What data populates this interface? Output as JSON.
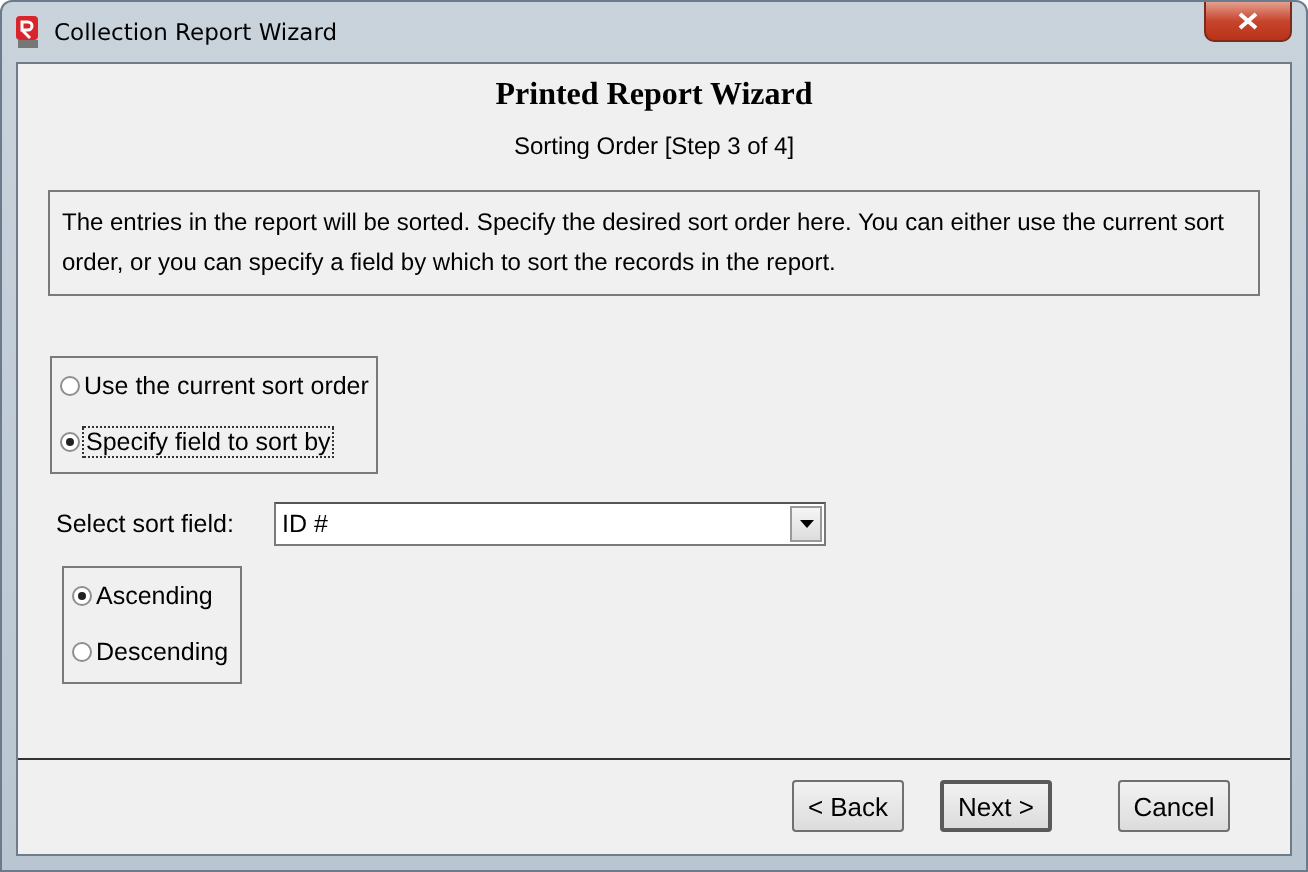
{
  "window": {
    "title": "Collection Report Wizard"
  },
  "header": {
    "title": "Printed Report Wizard",
    "subtitle": "Sorting Order [Step 3 of 4]"
  },
  "description": "The entries in the report will be sorted.  Specify the desired sort order here. You can either use the current sort order, or you can specify a field by which to sort the records in the report.",
  "sort_source": [
    {
      "label": "Use the current sort order",
      "selected": false
    },
    {
      "label": "Specify field to sort by",
      "selected": true
    }
  ],
  "sort_field": {
    "label": "Select sort field:",
    "value": "ID #"
  },
  "sort_direction": [
    {
      "label": "Ascending",
      "selected": true
    },
    {
      "label": "Descending",
      "selected": false
    }
  ],
  "buttons": [
    {
      "label": "< Back",
      "default": false
    },
    {
      "label": "Next >",
      "default": true
    },
    {
      "label": "Cancel",
      "default": false
    }
  ]
}
